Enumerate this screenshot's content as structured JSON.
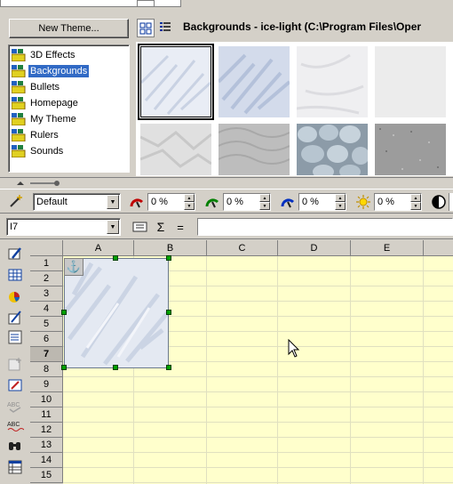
{
  "gallery": {
    "new_theme_label": "New Theme...",
    "title": "Backgrounds - ice-light (C:\\Program Files\\Oper",
    "themes": [
      {
        "label": "3D Effects"
      },
      {
        "label": "Backgrounds",
        "selected": true
      },
      {
        "label": "Bullets"
      },
      {
        "label": "Homepage"
      },
      {
        "label": "My Theme"
      },
      {
        "label": "Rulers"
      },
      {
        "label": "Sounds"
      }
    ],
    "thumbnails": [
      {
        "name": "ice-light",
        "selected": true
      },
      {
        "name": "ice-blue"
      },
      {
        "name": "white-paper"
      },
      {
        "name": "light-gray"
      },
      {
        "name": "white-crumple"
      },
      {
        "name": "gray-ripple"
      },
      {
        "name": "stones"
      },
      {
        "name": "gray-noise"
      }
    ]
  },
  "object_bar": {
    "style_value": "Default",
    "red_value": "0 %",
    "green_value": "0 %",
    "blue_value": "0 %",
    "brightness_value": "0 %"
  },
  "formula_bar": {
    "name_box_value": "I7",
    "sum_label": "Σ",
    "equals_label": "=",
    "formula_value": ""
  },
  "sheet": {
    "columns": [
      "A",
      "B",
      "C",
      "D",
      "E"
    ],
    "rows": [
      "1",
      "2",
      "3",
      "4",
      "5",
      "6",
      "7",
      "8",
      "9",
      "10",
      "11",
      "12",
      "13",
      "14",
      "15"
    ],
    "active_row": "7"
  },
  "colors": {
    "selection": "#316ac5",
    "sheet_background": "#ffffcc",
    "handle": "#00a000"
  }
}
